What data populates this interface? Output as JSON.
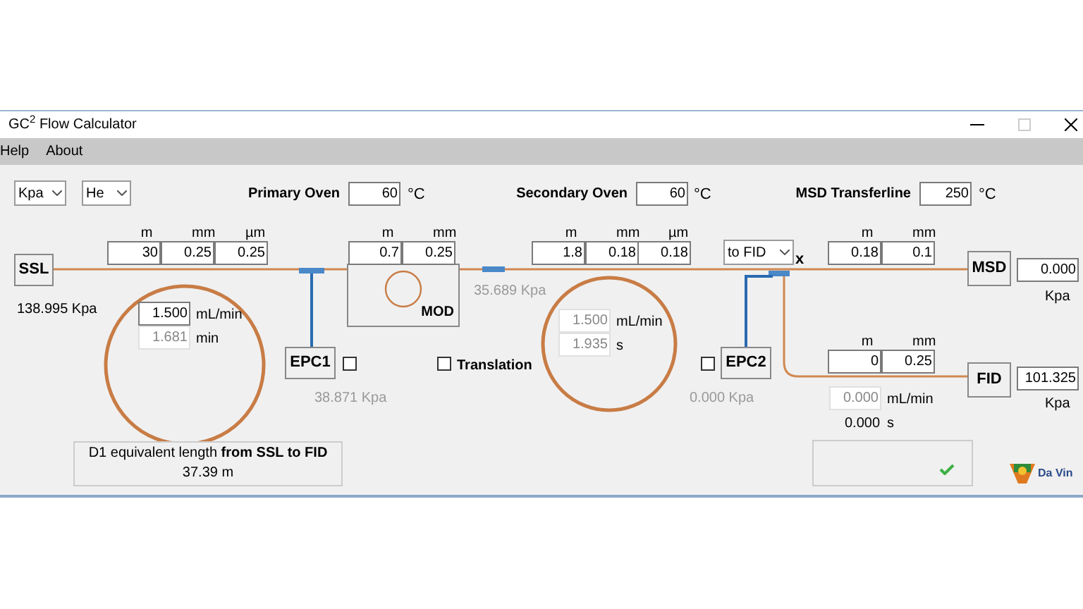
{
  "window": {
    "title": "GC$^{2}$ Flow Calculator"
  },
  "menu": [
    "Help",
    "About"
  ],
  "unit_selects": [
    {
      "value": "Kpa"
    },
    {
      "value": "He"
    }
  ],
  "ovens": [
    {
      "label": "Primary Oven",
      "value": "60",
      "unit": "°C"
    },
    {
      "label": "Secondary Oven",
      "value": "60",
      "unit": "°C"
    },
    {
      "label": "MSD Transferline",
      "value": "250",
      "unit": "°C"
    }
  ],
  "inlet": {
    "label": "SSL",
    "pressure": "138.995 Kpa"
  },
  "columns": [
    {
      "headers": [
        "m",
        "mm",
        "µm"
      ],
      "inputs": [
        "30",
        "0.25",
        "0.25"
      ],
      "readouts": [
        {
          "kind": "field",
          "value": "1.500",
          "unit": "mL/min",
          "disabled": false
        },
        {
          "kind": "field",
          "value": "1.681",
          "unit": "min",
          "disabled": true
        }
      ]
    },
    {
      "headers": [
        "m",
        "mm"
      ],
      "inputs": [
        "0.7",
        "0.25"
      ]
    },
    {
      "headers": [
        "m",
        "mm",
        "µm"
      ],
      "inputs": [
        "1.8",
        "0.18",
        "0.18"
      ],
      "readouts": [
        {
          "kind": "field",
          "value": "1.500",
          "unit": "mL/min",
          "disabled": true
        },
        {
          "kind": "field",
          "value": "1.935",
          "unit": "s",
          "disabled": true
        }
      ]
    },
    {
      "headers": [
        "m",
        "mm"
      ],
      "inputs": [
        "0.18",
        "0.1"
      ]
    },
    {
      "headers": [
        "m",
        "mm"
      ],
      "inputs": [
        "0",
        "0.25"
      ],
      "readouts": [
        {
          "kind": "field",
          "value": "0.000",
          "unit": "mL/min",
          "disabled": true
        },
        {
          "kind": "text",
          "value": "0.000",
          "unit": "s"
        }
      ]
    }
  ],
  "modulator": {
    "label": "MOD",
    "pressure": "35.689 Kpa"
  },
  "epcs": [
    {
      "label": "EPC1",
      "checked": false,
      "pressure": "38.871 Kpa"
    },
    {
      "label": "EPC2",
      "checked": false,
      "pressure": "0.000 Kpa"
    }
  ],
  "translation": {
    "label": "Translation",
    "checked": false
  },
  "split": {
    "value": "to FID",
    "mark": "x"
  },
  "detectors": [
    {
      "label": "MSD",
      "pressure": "0.000",
      "unit": "Kpa"
    },
    {
      "label": "FID",
      "pressure": "101.325",
      "unit": "Kpa"
    }
  ],
  "summary": {
    "text": "D1 equivalent length **from SSL to FID**",
    "value": "37.39 m"
  },
  "status": {
    "ok": true
  },
  "logo": {
    "text": "Da Vin"
  }
}
